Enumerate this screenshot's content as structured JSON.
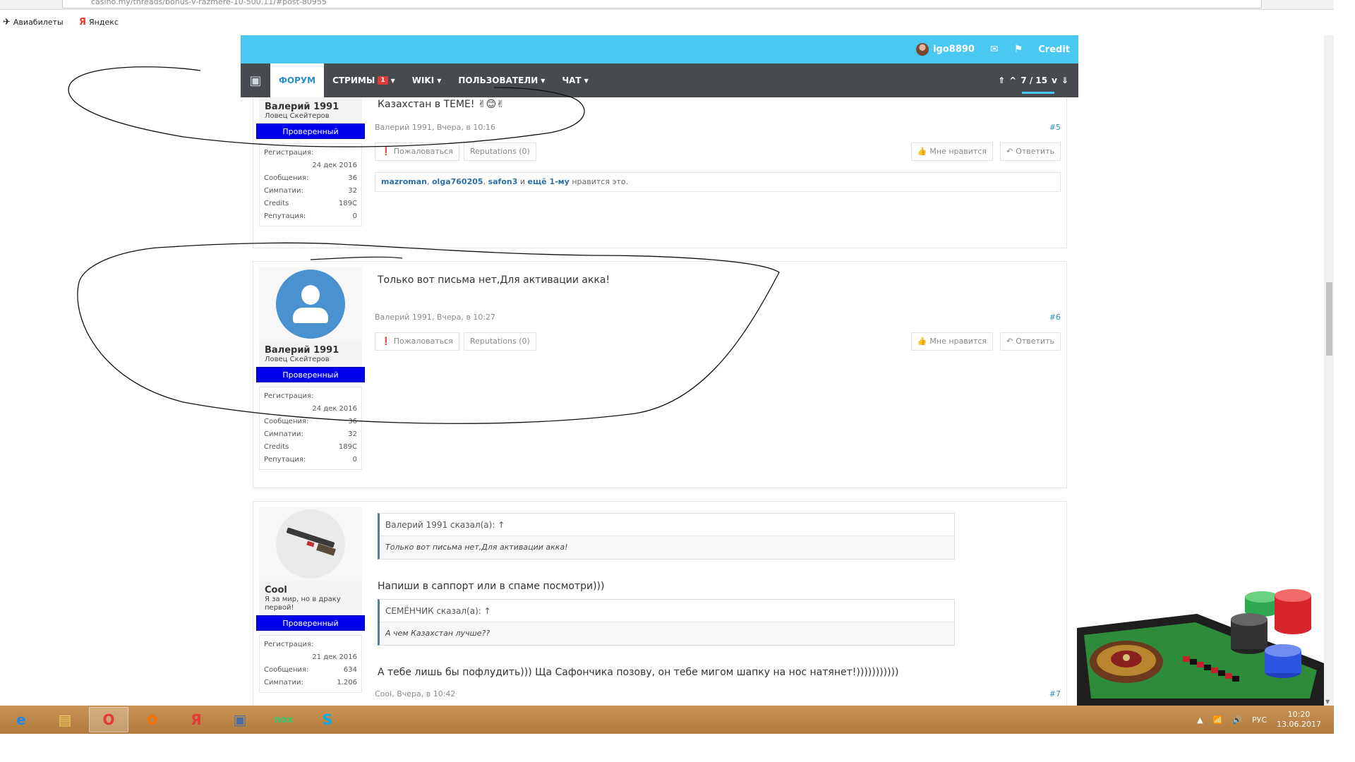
{
  "browser": {
    "url": "casino.my/threads/bonus-v-razmere-10-500.11/#post-80955",
    "bookmarks": [
      {
        "label": "Авиабилеты",
        "icon": "plane-icon"
      },
      {
        "label": "Яндекс",
        "icon": "yandex-icon"
      }
    ]
  },
  "topbar": {
    "username": "igo8890",
    "credit_label": "Credit"
  },
  "nav": {
    "items": [
      {
        "label": "ФОРУМ"
      },
      {
        "label": "СТРИМЫ",
        "badge": "1"
      },
      {
        "label": "WIKI"
      },
      {
        "label": "ПОЛЬЗОВАТЕЛИ"
      },
      {
        "label": "ЧАТ"
      }
    ],
    "pager": "7 / 15"
  },
  "post5": {
    "author": "Валерий 1991",
    "user_title": "Ловец Скейтеров",
    "badge": "Проверенный",
    "stats": {
      "reg_label": "Регистрация:",
      "reg_date": "24 дек 2016",
      "msg_label": "Сообщения:",
      "msg_value": "36",
      "sym_label": "Симпатии:",
      "sym_value": "32",
      "cred_label": "Credits",
      "cred_value": "189C",
      "rep_label": "Репутация:",
      "rep_value": "0"
    },
    "message": "Казахстан в ТЕМЕ! ✌😊✌",
    "meta": "Валерий 1991, Вчера, в 10:16",
    "number": "#5",
    "report": "Пожаловаться",
    "reputations": "Reputations (0)",
    "like": "Мне нравится",
    "reply": "Ответить",
    "likes": {
      "user1": "mazroman",
      "sep1": ", ",
      "user2": "olga760205",
      "sep2": ", ",
      "user3": "safon3",
      "and": " и ",
      "more": "ещё 1-му",
      "suffix": " нравится это."
    }
  },
  "post6": {
    "author": "Валерий 1991",
    "user_title": "Ловец Скейтеров",
    "badge": "Проверенный",
    "stats": {
      "reg_label": "Регистрация:",
      "reg_date": "24 дек 2016",
      "msg_label": "Сообщения:",
      "msg_value": "36",
      "sym_label": "Симпатии:",
      "sym_value": "32",
      "cred_label": "Credits",
      "cred_value": "189C",
      "rep_label": "Репутация:",
      "rep_value": "0"
    },
    "message": "Только вот письма нет,Для активации акка!",
    "meta": "Валерий 1991, Вчера, в 10:27",
    "number": "#6",
    "report": "Пожаловаться",
    "reputations": "Reputations (0)",
    "like": "Мне нравится",
    "reply": "Ответить"
  },
  "post7": {
    "author": "Cool",
    "user_title": "Я за мир, но в драку первой!",
    "badge": "Проверенный",
    "stats": {
      "reg_label": "Регистрация:",
      "reg_date": "21 дек 2016",
      "msg_label": "Сообщения:",
      "msg_value": "634",
      "sym_label": "Симпатии:",
      "sym_value": "1.206"
    },
    "quote1_head": "Валерий 1991 сказал(а): ↑",
    "quote1_body": "Только вот письма нет,Для активации акка!",
    "text1": "Напиши в саппорт или в спаме посмотри)))",
    "quote2_head": "СЕМЁНЧИК сказал(а): ↑",
    "quote2_body": "А чем Казахстан лучше??",
    "text2": "А тебе лишь бы пофлудить))) Ща Сафончика позову, он тебе мигом шапку на нос натянет!)))))))))))",
    "meta": "Cool, Вчера, в 10:42",
    "number": "#7"
  },
  "taskbar": {
    "apps": [
      {
        "name": "internet-explorer-icon",
        "glyph": "e",
        "color": "#1e88e5"
      },
      {
        "name": "file-explorer-icon",
        "glyph": "▤",
        "color": "#f0d060"
      },
      {
        "name": "opera-icon",
        "glyph": "O",
        "color": "#e53935",
        "active": true
      },
      {
        "name": "media-player-icon",
        "glyph": "✿",
        "color": "#ff6d00"
      },
      {
        "name": "yandex-browser-icon",
        "glyph": "Я",
        "color": "#e53935"
      },
      {
        "name": "network-app-icon",
        "glyph": "▣",
        "color": "#4a6fa5"
      },
      {
        "name": "nox-player-icon",
        "glyph": "nox",
        "color": "#2ecc71"
      },
      {
        "name": "skype-icon",
        "glyph": "S",
        "color": "#00aff0"
      }
    ],
    "lang": "РУС",
    "time": "10:20",
    "date": "13.06.2017"
  }
}
